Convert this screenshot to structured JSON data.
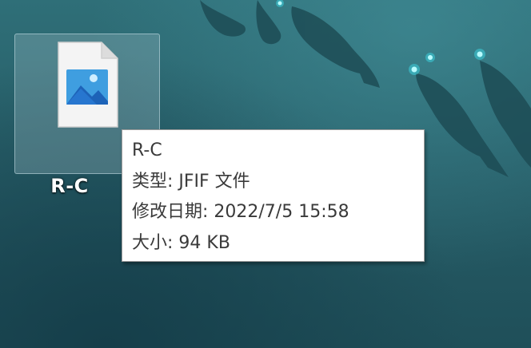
{
  "desktop": {
    "icons": [
      {
        "label": "R-C",
        "icon": "jpeg-image-file-icon",
        "selected": true
      }
    ]
  },
  "tooltip": {
    "name": "R-C",
    "type_line": "类型: JFIF 文件",
    "modified_line": "修改日期: 2022/7/5 15:58",
    "size_line": "大小: 94 KB"
  }
}
